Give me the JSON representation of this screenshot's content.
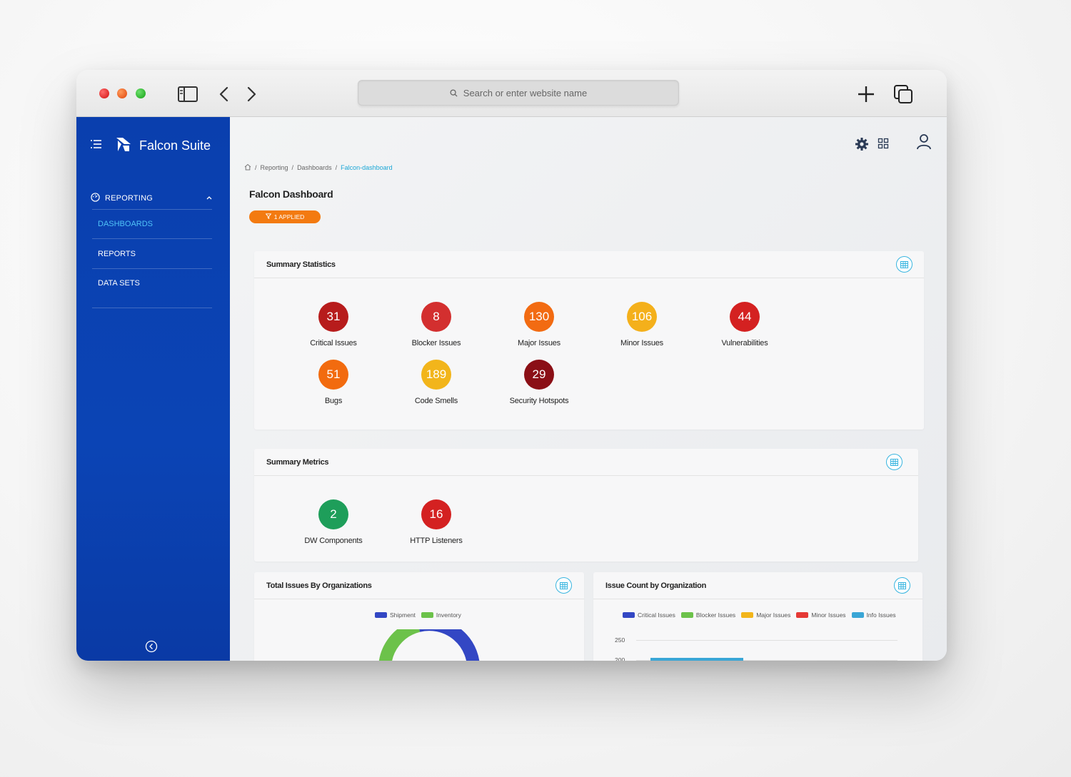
{
  "browser": {
    "search_placeholder": "Search or enter website name"
  },
  "sidebar": {
    "brand": "Falcon Suite",
    "section": "REPORTING",
    "items": [
      {
        "label": "DASHBOARDS",
        "active": true
      },
      {
        "label": "REPORTS",
        "active": false
      },
      {
        "label": "DATA SETS",
        "active": false
      }
    ]
  },
  "breadcrumb": {
    "items": [
      "Reporting",
      "Dashboards"
    ],
    "current": "Falcon-dashboard",
    "separator": "/"
  },
  "page": {
    "title": "Falcon Dashboard",
    "filter_chip": "1 APPLIED"
  },
  "summary_statistics": {
    "title": "Summary Statistics",
    "stats": [
      {
        "value": "31",
        "label": "Critical Issues",
        "color": "#b71c1c"
      },
      {
        "value": "8",
        "label": "Blocker Issues",
        "color": "#d32f2f"
      },
      {
        "value": "130",
        "label": "Major Issues",
        "color": "#f26b12"
      },
      {
        "value": "106",
        "label": "Minor Issues",
        "color": "#f4b01b"
      },
      {
        "value": "44",
        "label": "Vulnerabilities",
        "color": "#d42121"
      },
      {
        "value": "51",
        "label": "Bugs",
        "color": "#f26b0f"
      },
      {
        "value": "189",
        "label": "Code Smells",
        "color": "#f2b51b"
      },
      {
        "value": "29",
        "label": "Security Hotspots",
        "color": "#8b0f16"
      }
    ]
  },
  "summary_metrics": {
    "title": "Summary Metrics",
    "stats": [
      {
        "value": "2",
        "label": "DW Components",
        "color": "#1e9e5a"
      },
      {
        "value": "16",
        "label": "HTTP Listeners",
        "color": "#d42121"
      }
    ]
  },
  "total_issues_card": {
    "title": "Total Issues By Organizations",
    "legend": [
      {
        "name": "Shipment",
        "color": "#3347c4"
      },
      {
        "name": "Inventory",
        "color": "#6cc24a"
      }
    ]
  },
  "issue_count_card": {
    "title": "Issue Count by Organization",
    "legend": [
      {
        "name": "Critical Issues",
        "color": "#3347c4"
      },
      {
        "name": "Blocker Issues",
        "color": "#6cc24a"
      },
      {
        "name": "Major Issues",
        "color": "#f2b51b"
      },
      {
        "name": "Minor Issues",
        "color": "#e53935"
      },
      {
        "name": "Info Issues",
        "color": "#3aa6d6"
      }
    ],
    "y_ticks": [
      "250",
      "200"
    ]
  }
}
